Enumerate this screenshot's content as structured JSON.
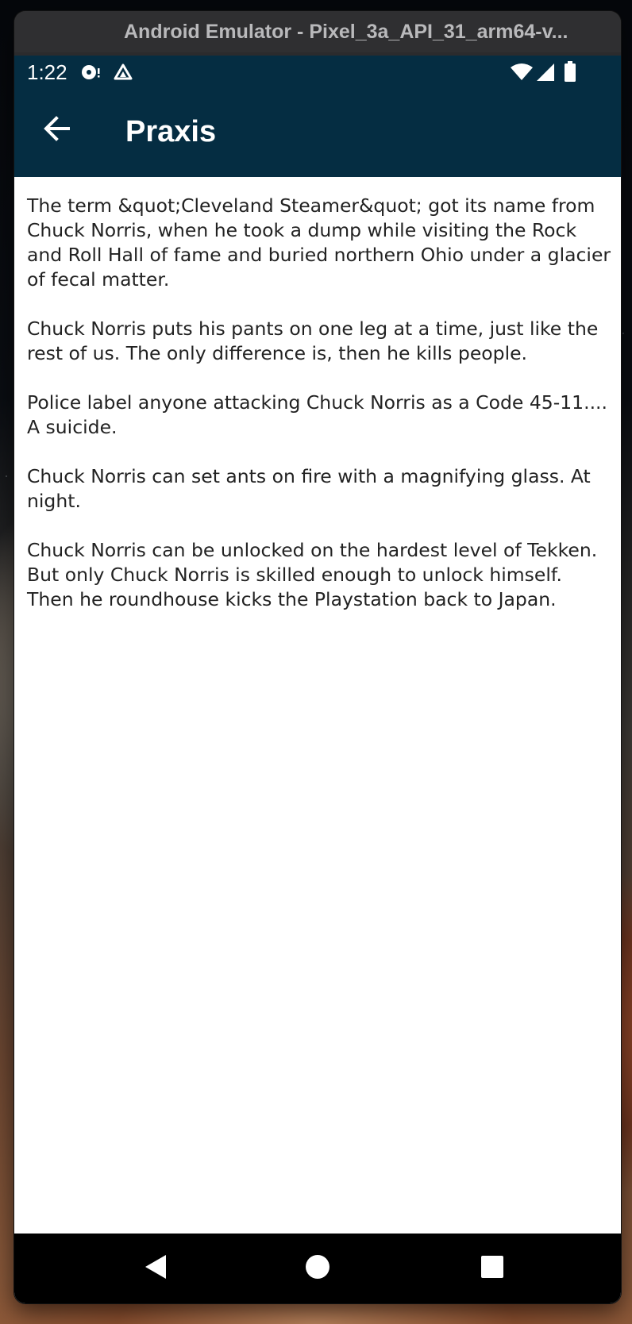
{
  "window": {
    "title": "Android Emulator - Pixel_3a_API_31_arm64-v..."
  },
  "status_bar": {
    "time": "1:22",
    "left_icons": [
      "notification-icon",
      "drive-icon"
    ],
    "right_icons": [
      "wifi-icon",
      "signal-icon",
      "battery-icon"
    ]
  },
  "app_bar": {
    "title": "Praxis",
    "back_icon": "arrow-back-icon",
    "background_color": "#052d42"
  },
  "content": {
    "paragraphs": [
      "The term &quot;Cleveland Steamer&quot; got its name from Chuck Norris, when he took a dump while visiting the Rock and Roll Hall of fame and buried northern Ohio under a glacier of fecal matter.",
      "Chuck Norris puts his pants on one leg at a time, just like the rest of us. The only difference is, then he kills people.",
      "Police label anyone attacking Chuck Norris as a Code 45-11.... A suicide.",
      "Chuck Norris can set ants on fire with a magnifying glass. At night.",
      "Chuck Norris can be unlocked on the hardest level of Tekken. But only Chuck Norris is skilled enough to unlock himself. Then he roundhouse kicks the Playstation back to Japan."
    ]
  },
  "nav_bar": {
    "buttons": [
      "back-triangle-icon",
      "home-circle-icon",
      "overview-square-icon"
    ]
  }
}
